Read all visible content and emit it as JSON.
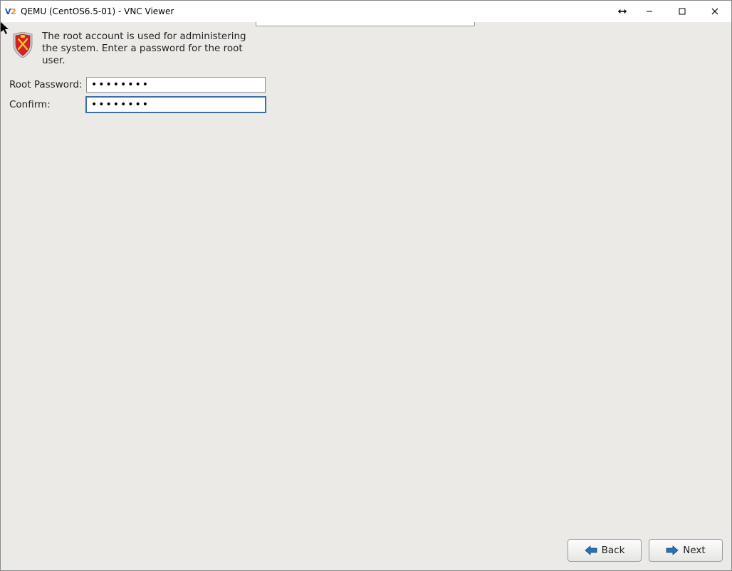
{
  "window": {
    "title": "QEMU (CentOS6.5-01) - VNC Viewer"
  },
  "installer": {
    "description": "The root account is used for administering the system.  Enter a password for the root user.",
    "root_password_label": "Root Password:",
    "confirm_label": "Confirm:",
    "root_password_value": "••••••••",
    "confirm_value": "••••••••"
  },
  "buttons": {
    "back": "Back",
    "next": "Next"
  }
}
